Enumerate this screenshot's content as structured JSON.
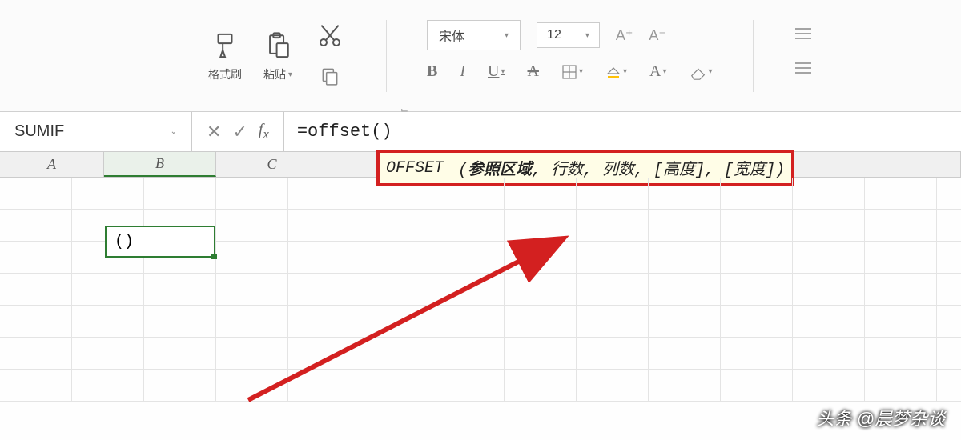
{
  "ribbon": {
    "format_brush": "格式刷",
    "paste": "粘贴",
    "font_name": "宋体",
    "font_size": "12"
  },
  "formula_bar": {
    "name_box": "SUMIF",
    "formula": "=offset()"
  },
  "columns": {
    "a": "A",
    "b": "B",
    "c": "C"
  },
  "tooltip": {
    "fn": "OFFSET",
    "arg1": "参照区域",
    "rest": ", 行数, 列数, [高度], [宽度])"
  },
  "active_cell": {
    "value": "()"
  },
  "watermark": "头条 @晨梦杂谈"
}
